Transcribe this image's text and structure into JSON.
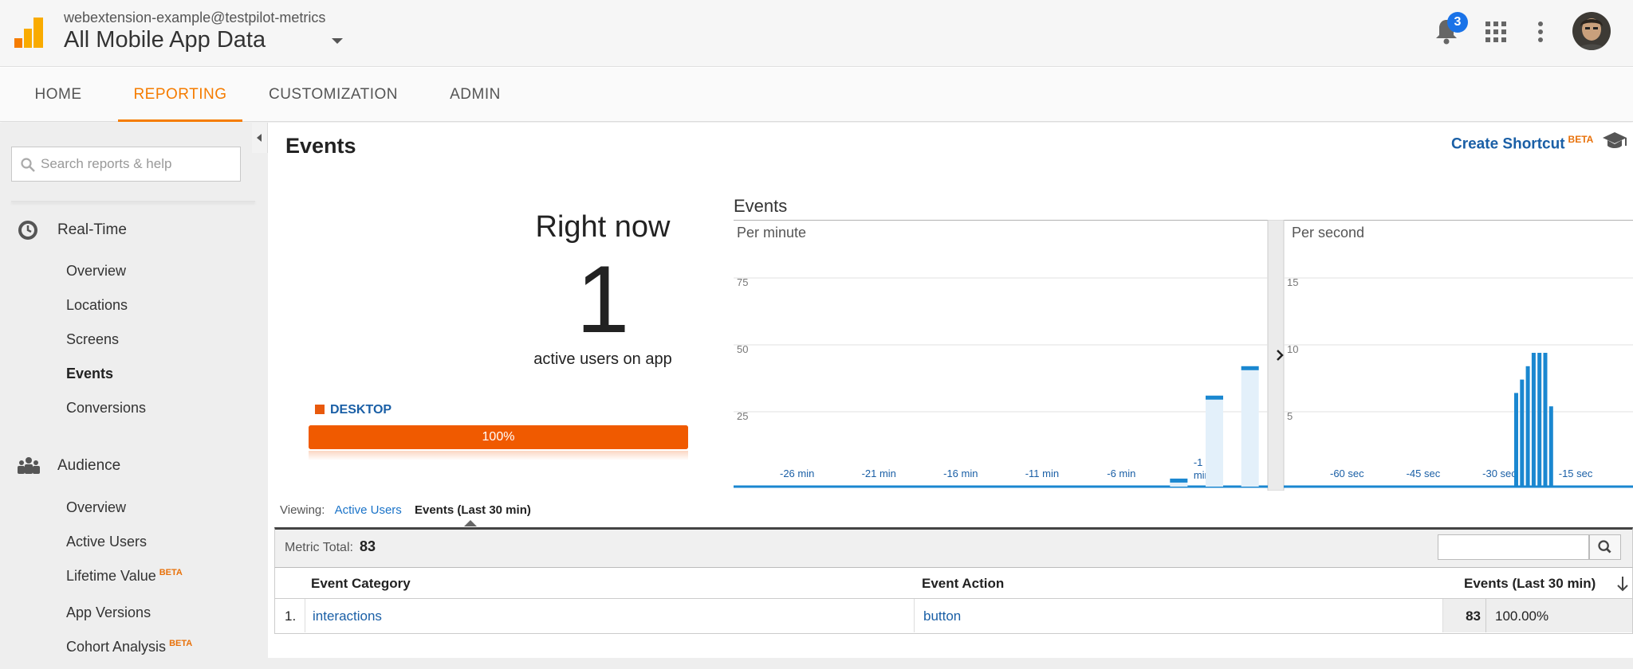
{
  "header": {
    "account": "webextension-example@testpilot-metrics",
    "property": "All Mobile App Data",
    "notification_count": "3",
    "brand_color": "#f9ab00"
  },
  "topnav": {
    "tabs": [
      {
        "label": "HOME"
      },
      {
        "label": "REPORTING"
      },
      {
        "label": "CUSTOMIZATION"
      },
      {
        "label": "ADMIN"
      }
    ],
    "active": "REPORTING",
    "active_color": "#f57c00"
  },
  "sidebar": {
    "search_placeholder": "Search reports & help",
    "realtime": {
      "label": "Real-Time",
      "items": [
        {
          "label": "Overview"
        },
        {
          "label": "Locations"
        },
        {
          "label": "Screens"
        },
        {
          "label": "Events"
        },
        {
          "label": "Conversions"
        }
      ],
      "active": "Events"
    },
    "audience": {
      "label": "Audience",
      "items": [
        {
          "label": "Overview"
        },
        {
          "label": "Active Users"
        },
        {
          "label": "Lifetime Value",
          "badge": "BETA"
        },
        {
          "label": "App Versions"
        },
        {
          "label": "Cohort Analysis",
          "badge": "BETA"
        }
      ]
    }
  },
  "page": {
    "title": "Events",
    "create_shortcut": "Create Shortcut",
    "beta": "BETA"
  },
  "right_now": {
    "label": "Right now",
    "value": "1",
    "subtitle": "active users on app",
    "device": "DESKTOP",
    "device_percent_label": "100%",
    "device_fraction": 1.0,
    "device_color": "#e8590c"
  },
  "chart_data": [
    {
      "type": "bar",
      "title": "Events",
      "subtitle": "Per minute",
      "x_tick_labels": [
        "-26 min",
        "-21 min",
        "-16 min",
        "-11 min",
        "-6 min",
        "-1 min"
      ],
      "y_ticks": [
        25,
        50,
        75
      ],
      "ylim": [
        0,
        100
      ],
      "minutes_ago": [
        5,
        3,
        1
      ],
      "values": [
        3,
        34,
        45
      ],
      "bar_color": "#1a87d0",
      "grid": true
    },
    {
      "type": "bar",
      "subtitle": "Per second",
      "x_tick_labels": [
        "-60 sec",
        "-45 sec",
        "-30 sec",
        "-15 sec"
      ],
      "y_ticks": [
        5,
        10,
        15
      ],
      "ylim": [
        0,
        20
      ],
      "seconds_ago": [
        20,
        19,
        18,
        17,
        16,
        15,
        14
      ],
      "values": [
        7,
        8,
        9,
        10,
        10,
        10,
        6
      ],
      "bar_color": "#1a87d0",
      "grid": true
    }
  ],
  "viewing": {
    "label": "Viewing:",
    "tab_active_users": "Active Users",
    "tab_events": "Events (Last 30 min)"
  },
  "metric": {
    "label": "Metric Total:",
    "value": "83"
  },
  "table": {
    "columns": [
      "Event Category",
      "Event Action",
      "Events (Last 30 min)"
    ],
    "rows": [
      {
        "index": "1.",
        "category": "interactions",
        "action": "button",
        "events": "83",
        "percent": "100.00%"
      }
    ]
  }
}
